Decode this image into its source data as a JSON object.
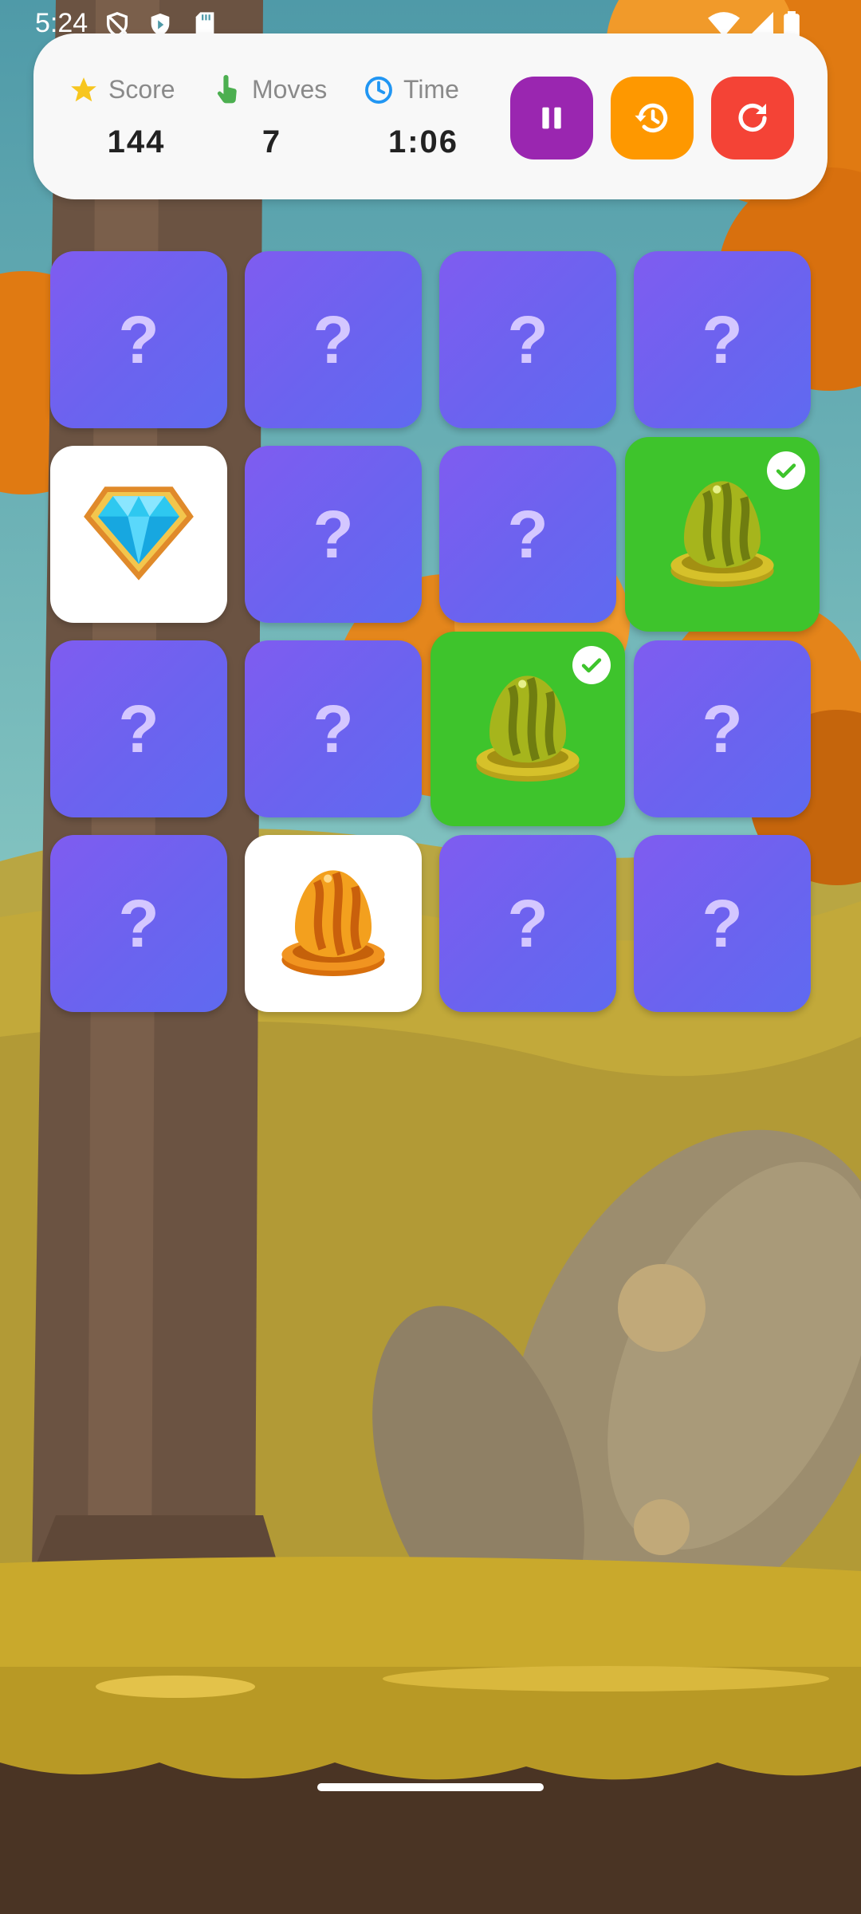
{
  "status_bar": {
    "time": "5:24"
  },
  "hud": {
    "score": {
      "label": "Score",
      "value": "144"
    },
    "moves": {
      "label": "Moves",
      "value": "7"
    },
    "time": {
      "label": "Time",
      "value": "1:06"
    },
    "buttons": [
      "pause",
      "history",
      "restart"
    ]
  },
  "board": {
    "rows": 4,
    "cols": 4,
    "hidden_symbol": "?",
    "cards": [
      {
        "state": "hidden"
      },
      {
        "state": "hidden"
      },
      {
        "state": "hidden"
      },
      {
        "state": "hidden"
      },
      {
        "state": "revealed",
        "icon": "diamond-icon"
      },
      {
        "state": "hidden"
      },
      {
        "state": "hidden"
      },
      {
        "state": "matched",
        "icon": "green-egg-icon"
      },
      {
        "state": "hidden"
      },
      {
        "state": "hidden"
      },
      {
        "state": "matched",
        "icon": "green-egg-icon"
      },
      {
        "state": "hidden"
      },
      {
        "state": "hidden"
      },
      {
        "state": "revealed",
        "icon": "orange-egg-icon"
      },
      {
        "state": "hidden"
      },
      {
        "state": "hidden"
      }
    ]
  },
  "colors": {
    "pause": "#9a26b0",
    "history": "#fe9800",
    "restart": "#f44336",
    "card_hidden": "#6f5fef",
    "card_matched": "#3ec42c"
  }
}
